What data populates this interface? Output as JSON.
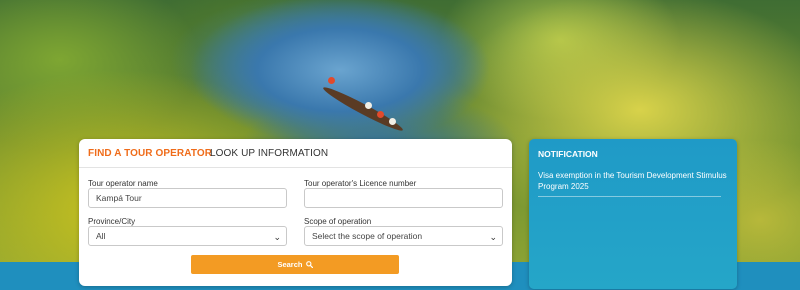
{
  "tabs": {
    "find": "FIND A TOUR OPERATOR",
    "lookup": "LOOK UP INFORMATION"
  },
  "form": {
    "operator_name_label": "Tour operator name",
    "operator_name_value": "Kampá Tour",
    "licence_label": "Tour operator's Licence number",
    "licence_value": "",
    "province_label": "Province/City",
    "province_value": "All",
    "scope_label": "Scope of operation",
    "scope_value": "Select the scope of operation",
    "search_label": "Search"
  },
  "notification": {
    "title": "NOTIFICATION",
    "items": [
      "Visa exemption in the Tourism Development Stimulus Program 2025"
    ]
  },
  "colors": {
    "accent_orange": "#ef6c1a",
    "button_orange": "#f39b23",
    "notification_blue": "#1f9ac7"
  },
  "icons": {
    "search": "search-icon",
    "dropdown": "chevron-down-icon"
  }
}
